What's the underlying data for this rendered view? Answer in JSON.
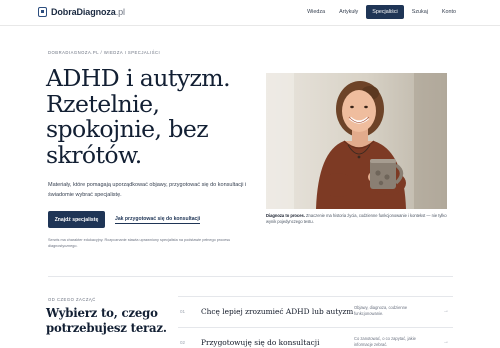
{
  "nav": {
    "logo": "DobraDiagnoza",
    "logo_tld": ".pl",
    "links": [
      "Wiedza",
      "Artykuły",
      "Specjaliści",
      "Szukaj",
      "Konto"
    ],
    "active_index": 2
  },
  "hero": {
    "breadcrumb": "DOBRADIAGNOZA.PL / WIEDZA I SPECJALIŚCI",
    "title": "ADHD i autyzm. Rzetelnie, spokojnie, bez skrótów.",
    "subtitle": "Materiały, które pomagają uporządkować objawy, przygotować się do konsultacji i świadomie wybrać specjalistę.",
    "primary_button": "Znajdź specjalistę",
    "secondary_link": "Jak przygotować się do konsultacji",
    "disclaimer": "Serwis ma charakter edukacyjny. Rozpoznanie stawia uprawniony specjalista na podstawie pełnego procesu diagnostycznego.",
    "caption_bold": "Diagnoza to proces.",
    "caption_text": "Znaczenie ma historia życia, codzienne funkcjonowanie i kontekst — nie tylko wynik pojedynczego testu."
  },
  "section": {
    "label": "OD CZEGO ZACZĄĆ",
    "title": "Wybierz to, czego potrzebujesz teraz.",
    "options": [
      {
        "num": "01",
        "title": "Chcę lepiej zrozumieć ADHD lub autyzm",
        "desc": "Objawy, diagnoza, codzienne funkcjonowanie.",
        "arrow": "→"
      },
      {
        "num": "02",
        "title": "Przygotowuję się do konsultacji",
        "desc": "Co zanotować, o co zapytać, jakie informacje zebrać.",
        "arrow": "→"
      }
    ]
  },
  "colors": {
    "accent": "#1f3556",
    "title": "#121f33",
    "muted": "#6b7280"
  },
  "icons": {
    "logo": "logo-mark-icon",
    "arrow": "arrow-right-icon"
  }
}
